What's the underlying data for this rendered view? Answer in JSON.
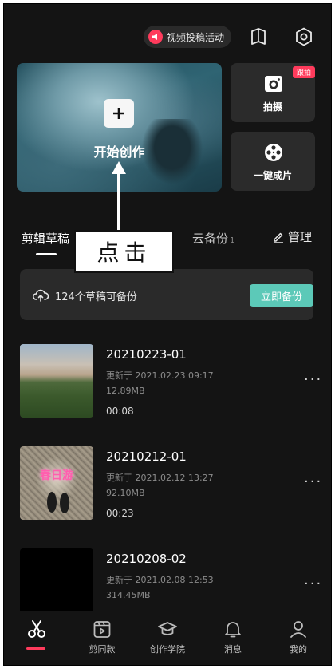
{
  "top_bar": {
    "activity_label": "视频投稿活动",
    "icons": [
      "megaphone-icon",
      "tutorial-book-icon",
      "settings-icon"
    ]
  },
  "hero": {
    "label": "开始创作",
    "icon": "plus-icon"
  },
  "side_cards": [
    {
      "label": "拍摄",
      "badge": "跟拍",
      "icon": "camera-icon"
    },
    {
      "label": "一键成片",
      "icon": "film-reel-icon"
    }
  ],
  "tabs": {
    "drafts": "剪辑草稿",
    "cloud": "云备份",
    "cloud_count": "1",
    "manage": "管理"
  },
  "annotation": {
    "text": "点击"
  },
  "backup": {
    "message": "124个草稿可备份",
    "button": "立即备份"
  },
  "drafts": [
    {
      "name": "20210223-01",
      "updated": "更新于 2021.02.23 09:17",
      "size": "12.89MB",
      "duration": "00:08"
    },
    {
      "name": "20210212-01",
      "updated": "更新于 2021.02.12 13:27",
      "size": "92.10MB",
      "duration": "00:23",
      "thumb_text": "春日游"
    },
    {
      "name": "20210208-02",
      "updated": "更新于 2021.02.08 12:53",
      "size": "314.45MB"
    }
  ],
  "more_label": "···",
  "bottom_nav": [
    {
      "label": "",
      "icon": "scissors-icon",
      "active": true
    },
    {
      "label": "剪同款",
      "icon": "template-icon"
    },
    {
      "label": "创作学院",
      "icon": "graduation-cap-icon"
    },
    {
      "label": "消息",
      "icon": "bell-icon"
    },
    {
      "label": "我的",
      "icon": "profile-icon"
    }
  ],
  "colors": {
    "background": "#141414",
    "accent": "#ff3b5c",
    "backup_button": "#5cc9b8",
    "card": "#2b2b2b"
  }
}
